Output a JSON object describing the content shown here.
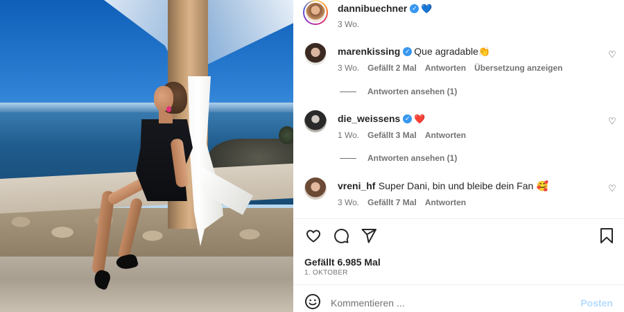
{
  "post": {
    "author": "dannibuechner",
    "author_heart": "💙",
    "age": "3 Wo."
  },
  "comments": [
    {
      "username": "marenkissing",
      "text": "Que agradable",
      "emoji": "👏",
      "age": "3 Wo.",
      "likes": "Gefällt 2 Mal",
      "reply": "Antworten",
      "translate": "Übersetzung anzeigen",
      "view_replies": "Antworten ansehen (1)"
    },
    {
      "username": "die_weissens",
      "text": "",
      "emoji": "❤️",
      "age": "1 Wo.",
      "likes": "Gefällt 3 Mal",
      "reply": "Antworten",
      "view_replies": "Antworten ansehen (1)"
    },
    {
      "username": "vreni_hf",
      "text": "Super Dani, bin und bleibe dein Fan",
      "emoji": "🥰",
      "age": "3 Wo.",
      "likes": "Gefällt 7 Mal",
      "reply": "Antworten"
    }
  ],
  "footer": {
    "likes_count": "Gefällt 6.985 Mal",
    "date": "1. OKTOBER",
    "comment_placeholder": "Kommentieren ...",
    "post_label": "Posten"
  },
  "icons": {
    "like": "heart-outline-icon",
    "comment": "comment-bubble-icon",
    "share": "paper-plane-icon",
    "save": "bookmark-icon",
    "emoji": "smiley-icon"
  },
  "colors": {
    "verified": "#3897f0",
    "post_button_disabled": "#b3dbff",
    "muted_text": "#737373"
  }
}
